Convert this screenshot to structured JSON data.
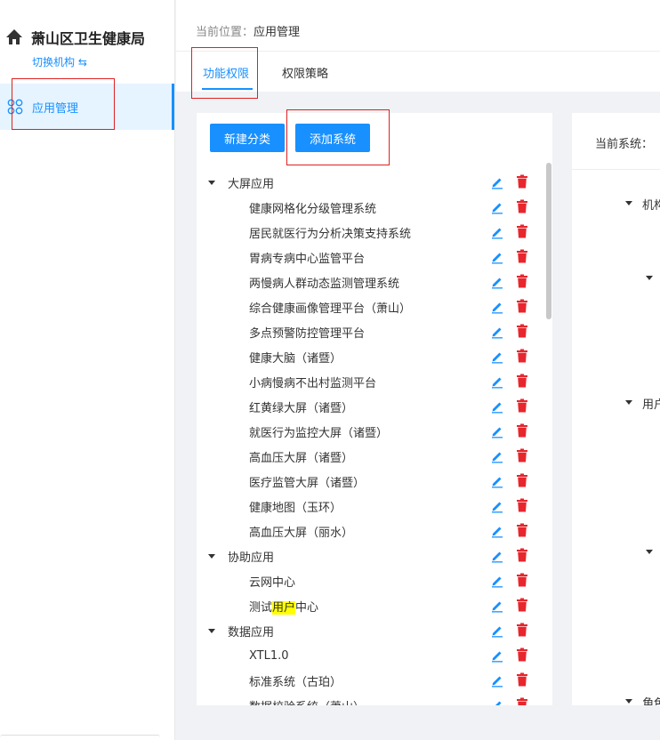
{
  "sidebar": {
    "org_name": "萧山区卫生健康局",
    "switch_org": "切换机构 ⇆",
    "menu_item_label": "应用管理"
  },
  "header": {
    "breadcrumb_prefix": "当前位置：",
    "breadcrumb_current": "应用管理"
  },
  "tabs": [
    {
      "label": "功能权限",
      "active": true
    },
    {
      "label": "权限策略",
      "active": false
    }
  ],
  "left_panel": {
    "new_category_button": "新建分类",
    "add_system_button": "添加系统",
    "tree": [
      {
        "label": "大屏应用",
        "type": "category"
      },
      {
        "label": "健康网格化分级管理系统",
        "type": "leaf"
      },
      {
        "label": "居民就医行为分析决策支持系统",
        "type": "leaf"
      },
      {
        "label": "胃病专病中心监管平台",
        "type": "leaf"
      },
      {
        "label": "两慢病人群动态监测管理系统",
        "type": "leaf"
      },
      {
        "label": "综合健康画像管理平台（萧山）",
        "type": "leaf"
      },
      {
        "label": "多点预警防控管理平台",
        "type": "leaf"
      },
      {
        "label": "健康大脑（诸暨）",
        "type": "leaf"
      },
      {
        "label": "小病慢病不出村监测平台",
        "type": "leaf"
      },
      {
        "label": "红黄绿大屏（诸暨）",
        "type": "leaf"
      },
      {
        "label": "就医行为监控大屏（诸暨）",
        "type": "leaf"
      },
      {
        "label": "高血压大屏（诸暨）",
        "type": "leaf"
      },
      {
        "label": "医疗监管大屏（诸暨）",
        "type": "leaf"
      },
      {
        "label": "健康地图（玉环）",
        "type": "leaf"
      },
      {
        "label": "高血压大屏（丽水）",
        "type": "leaf"
      },
      {
        "label": "协助应用",
        "type": "category"
      },
      {
        "label": "云网中心",
        "type": "leaf"
      },
      {
        "label": "测试用户中心",
        "type": "leaf",
        "pre": "测试",
        "highlight": "用户",
        "post": "中心"
      },
      {
        "label": "数据应用",
        "type": "category"
      },
      {
        "label": "XTL1.0",
        "type": "leaf"
      },
      {
        "label": "标准系统（古珀）",
        "type": "leaf"
      },
      {
        "label": "数据校验系统（萧山）",
        "type": "leaf"
      }
    ]
  },
  "right_panel": {
    "current_system_label": "当前系统：",
    "sections": [
      {
        "label": "机构"
      },
      {
        "label": ""
      },
      {
        "label": "用户"
      },
      {
        "label": ""
      },
      {
        "label": "角色"
      }
    ]
  },
  "colors": {
    "accent": "#1890ff",
    "delete": "#e8262d",
    "annotation_box": "#e02020",
    "highlight": "#ffff00"
  }
}
